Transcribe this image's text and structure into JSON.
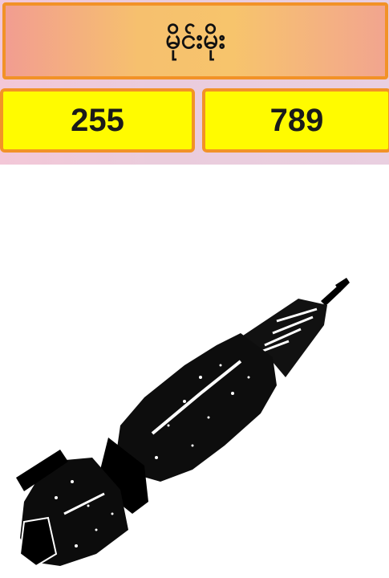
{
  "header": {
    "title": "မိုင်းမိုး"
  },
  "numbers": {
    "left": "255",
    "right": "789"
  },
  "image": {
    "subject": "projectile-illustration"
  },
  "colors": {
    "border": "#f29227",
    "number_bg": "#fffb00",
    "title_gradient_start": "#f29d91",
    "title_gradient_mid": "#f6c06e"
  }
}
